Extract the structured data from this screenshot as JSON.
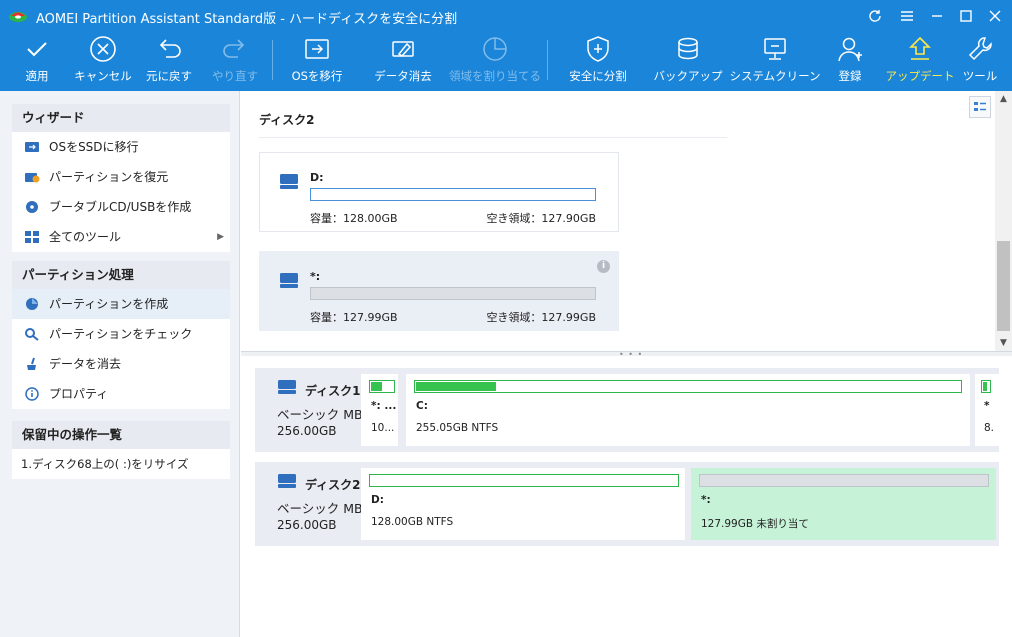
{
  "window": {
    "title": "AOMEI Partition Assistant Standard版 - ハードディスクを安全に分割"
  },
  "toolbar": {
    "items": [
      {
        "label": "適用",
        "icon": "check-icon"
      },
      {
        "label": "キャンセル",
        "icon": "cancel-icon"
      },
      {
        "label": "元に戻す",
        "icon": "undo-icon"
      },
      {
        "label": "やり直す",
        "icon": "redo-icon",
        "disabled": true
      },
      {
        "label": "OSを移行",
        "icon": "migrate-os-icon"
      },
      {
        "label": "データ消去",
        "icon": "wipe-data-icon"
      },
      {
        "label": "領域を割り当てる",
        "icon": "allocate-space-icon",
        "disabled": true
      },
      {
        "label": "安全に分割",
        "icon": "shield-icon"
      },
      {
        "label": "バックアップ",
        "icon": "backup-icon"
      },
      {
        "label": "システムクリーン",
        "icon": "system-clean-icon"
      },
      {
        "label": "登録",
        "icon": "register-user-icon"
      },
      {
        "label": "アップデート",
        "icon": "update-icon",
        "highlight": true
      },
      {
        "label": "ツール",
        "icon": "tools-icon"
      }
    ]
  },
  "sidebar": {
    "wizard": {
      "header": "ウィザード",
      "items": [
        {
          "label": "OSをSSDに移行"
        },
        {
          "label": "パーティションを復元"
        },
        {
          "label": "ブータブルCD/USBを作成"
        },
        {
          "label": "全てのツール",
          "arrow": "▶"
        }
      ]
    },
    "partition_ops": {
      "header": "パーティション処理",
      "items": [
        {
          "label": "パーティションを作成"
        },
        {
          "label": "パーティションをチェック"
        },
        {
          "label": "データを消去"
        },
        {
          "label": "プロパティ"
        }
      ]
    },
    "pending": {
      "header": "保留中の操作一覧",
      "items": [
        {
          "label": "1.ディスク68上の( :)をリサイズ"
        }
      ]
    }
  },
  "upper": {
    "disk_title": "ディスク2",
    "cards": [
      {
        "name": "D:",
        "capacity": "容量：128.00GB",
        "free": "空き領域：127.90GB",
        "used_fraction": 0.001
      },
      {
        "name": "*:",
        "capacity": "容量：127.99GB",
        "free": "空き領域：127.99GB",
        "info": "i"
      }
    ]
  },
  "disks": [
    {
      "name": "ディスク1",
      "type": "ベーシック MBR",
      "size": "256.00GB",
      "partitions": [
        {
          "label": "*: ...",
          "desc": "10...",
          "used_fraction": 0.5
        },
        {
          "label": "C:",
          "desc": "255.05GB NTFS",
          "used_fraction": 0.15
        },
        {
          "label": "*",
          "desc": "8.",
          "used_fraction": 0.5
        }
      ]
    },
    {
      "name": "ディスク2",
      "type": "ベーシック MBR",
      "size": "256.00GB",
      "partitions": [
        {
          "label": "D:",
          "desc": "128.00GB NTFS",
          "used_fraction": 0.0
        },
        {
          "label": "*:",
          "desc": "127.99GB 未割り当て",
          "unallocated": true
        }
      ]
    }
  ],
  "colors": {
    "toolbar_bg": "#1a85d9",
    "used_green": "#35c24e",
    "unallocated_bg": "#c6f3d8",
    "highlight_yellow": "#ffe94a"
  }
}
